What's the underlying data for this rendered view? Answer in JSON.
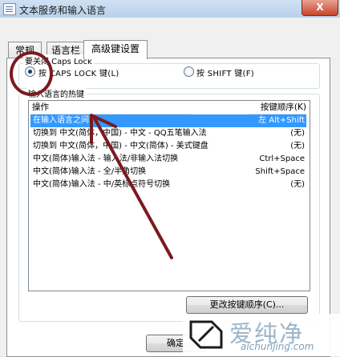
{
  "window": {
    "title": "文本服务和输入语言",
    "close_label": "X"
  },
  "tabs": [
    {
      "label": "常规",
      "active": false
    },
    {
      "label": "语言栏",
      "active": false
    },
    {
      "label": "高级键设置",
      "active": true
    }
  ],
  "caps_lock": {
    "legend": "要关闭 Caps Lock",
    "options": [
      {
        "label": "按 CAPS LOCK 键(L)",
        "checked": true
      },
      {
        "label": "按 SHIFT 键(F)",
        "checked": false
      }
    ]
  },
  "hotkeys": {
    "legend": "输入语言的热键",
    "columns": {
      "action": "操作",
      "key_sequence": "按键顺序(K)"
    },
    "rows": [
      {
        "action": "在输入语言之间",
        "keys": "左 Alt+Shift",
        "selected": true
      },
      {
        "action": "切换到 中文(简体，中国) - 中文 - QQ五笔输入法",
        "keys": "(无)",
        "selected": false
      },
      {
        "action": "切换到 中文(简体，中国) - 中文(简体) - 美式键盘",
        "keys": "(无)",
        "selected": false
      },
      {
        "action": "中文(简体)输入法 - 输入法/非输入法切换",
        "keys": "Ctrl+Space",
        "selected": false
      },
      {
        "action": "中文(简体)输入法 - 全/半角切换",
        "keys": "Shift+Space",
        "selected": false
      },
      {
        "action": "中文(简体)输入法 - 中/英标点符号切换",
        "keys": "(无)",
        "selected": false
      }
    ],
    "change_button": "更改按键顺序(C)..."
  },
  "footer": {
    "ok_button": "确定"
  },
  "watermark": {
    "brand": "爱纯净",
    "url": "aichunjing.com"
  },
  "annotation_color": "#7b1a1f",
  "selection_color": "#3399ff"
}
